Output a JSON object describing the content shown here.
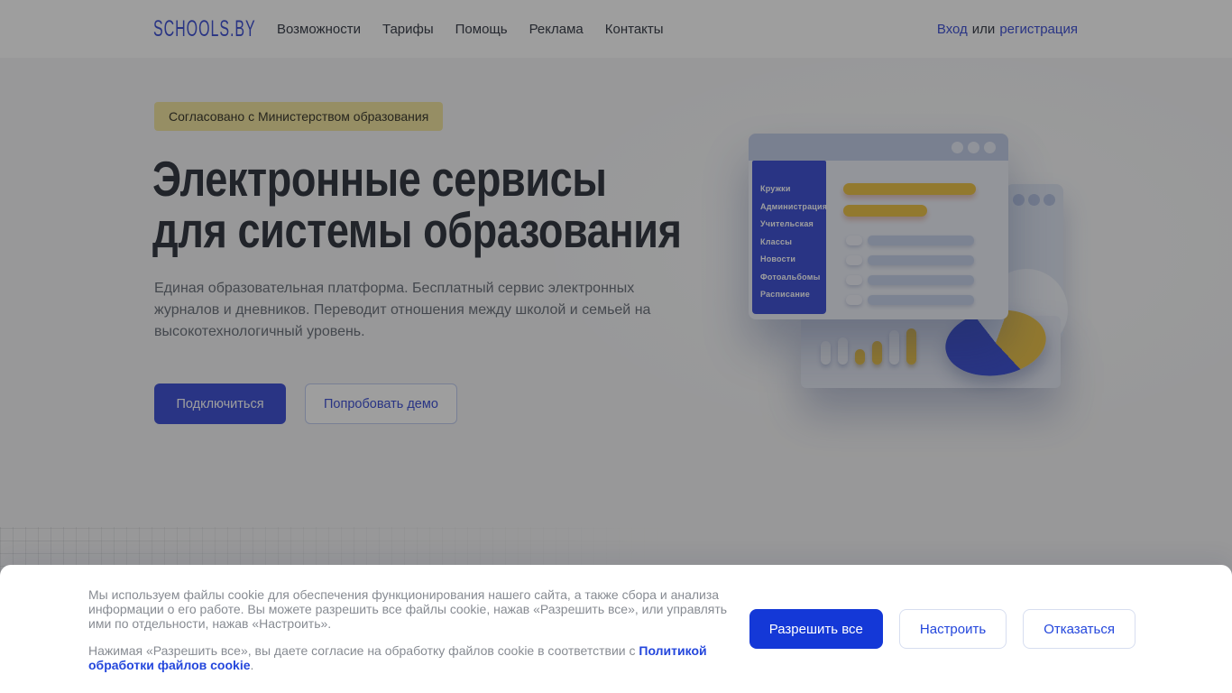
{
  "header": {
    "logo": "SCHOOLS.BY",
    "nav": [
      "Возможности",
      "Тарифы",
      "Помощь",
      "Реклама",
      "Контакты"
    ],
    "auth": {
      "login": "Вход",
      "separator": "или",
      "register": "регистрация"
    }
  },
  "hero": {
    "badge": "Согласовано с Министерством образования",
    "title_line1": "Электронные сервисы",
    "title_line2": "для системы образования",
    "description": "Единая образовательная платформа. Бесплатный сервис электронных журналов и дневников. Переводит отношения между школой и семьей на высокотехнологичный уровень.",
    "primary_button": "Подключиться",
    "secondary_button": "Попробовать демо"
  },
  "illustration": {
    "menu": [
      "Кружки",
      "Администрация",
      "Учительская",
      "Классы",
      "Новости",
      "Фотоальбомы",
      "Расписание"
    ],
    "icons": [
      "window-control-dots",
      "bar-chart",
      "pie-chart"
    ]
  },
  "cookie": {
    "paragraph1": "Мы используем файлы cookie для обеспечения функционирования нашего сайта, а также сбора и анализа информации о его работе. Вы можете разрешить все файлы cookie, нажав «Разрешить все», или управлять ими по отдельности, нажав «Настроить».",
    "p2_prefix": "Нажимая «Разрешить все», вы даете согласие на обработку файлов cookie в соответствии с ",
    "p2_link": "Политикой обработки файлов cookie",
    "p2_suffix": ".",
    "allow": "Разрешить все",
    "configure": "Настроить",
    "decline": "Отказаться"
  },
  "colors": {
    "brand": "#4355d6",
    "accent_yellow": "#ecc44d",
    "badge_bg": "#f2e5a2",
    "badge_text": "#3e3c30",
    "title": "#363b45",
    "nav_text": "#3c424c",
    "body_text": "#6e747e",
    "cookie_text": "#878b92",
    "cookie_link": "#2346dc",
    "cookie_primary": "#1438d7",
    "cookie_button_border": "#d7def0",
    "overlay": "rgba(0,0,0,0.38)"
  }
}
